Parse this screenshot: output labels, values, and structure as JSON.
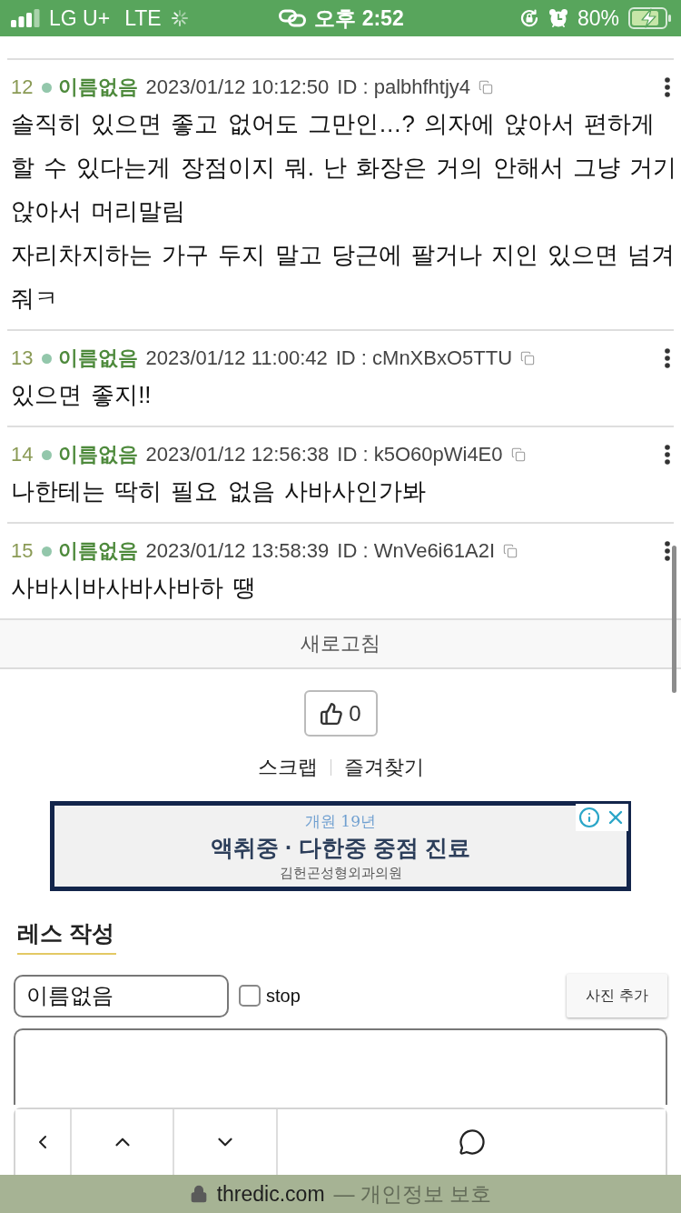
{
  "status_bar": {
    "carrier": "LG U+",
    "network": "LTE",
    "time": "오후 2:52",
    "battery": "80%"
  },
  "posts": [
    {
      "number": "12",
      "name": "이름없음",
      "date": "2023/01/12 10:12:50",
      "id": "ID : palbhfhtjy4",
      "body": "솔직히 있으면 좋고 없어도 그만인…? 의자에 앉아서 편하게 할 수 있다는게 장점이지 뭐. 난 화장은 거의 안해서 그냥 거기 앉아서 머리말림\n자리차지하는 가구 두지 말고 당근에 팔거나 지인 있으면 넘겨줘ㅋ"
    },
    {
      "number": "13",
      "name": "이름없음",
      "date": "2023/01/12 11:00:42",
      "id": "ID : cMnXBxO5TTU",
      "body": "있으면 좋지!!"
    },
    {
      "number": "14",
      "name": "이름없음",
      "date": "2023/01/12 12:56:38",
      "id": "ID : k5O60pWi4E0",
      "body": "나한테는 딱히 필요 없음 사바사인가봐"
    },
    {
      "number": "15",
      "name": "이름없음",
      "date": "2023/01/12 13:58:39",
      "id": "ID : WnVe6i61A2I",
      "body": "사바시바사바사바하 땡"
    }
  ],
  "refresh_button": "새로고침",
  "like_button": {
    "count": "0"
  },
  "links": [
    "스크랩",
    "즐겨찾기"
  ],
  "ad": {
    "tagline": "개원 19년",
    "headline": "액취중 · 다한중 중점 진료",
    "advertiser": "김헌곤성형외과의원"
  },
  "reply_form": {
    "title": "레스 작성",
    "name_value": "이름없음",
    "stop": {
      "label": "stop",
      "checked": false
    },
    "photo_button": "사진 추가"
  },
  "address_bar": {
    "domain": "thredic.com",
    "note": "— 개인정보 보호"
  }
}
